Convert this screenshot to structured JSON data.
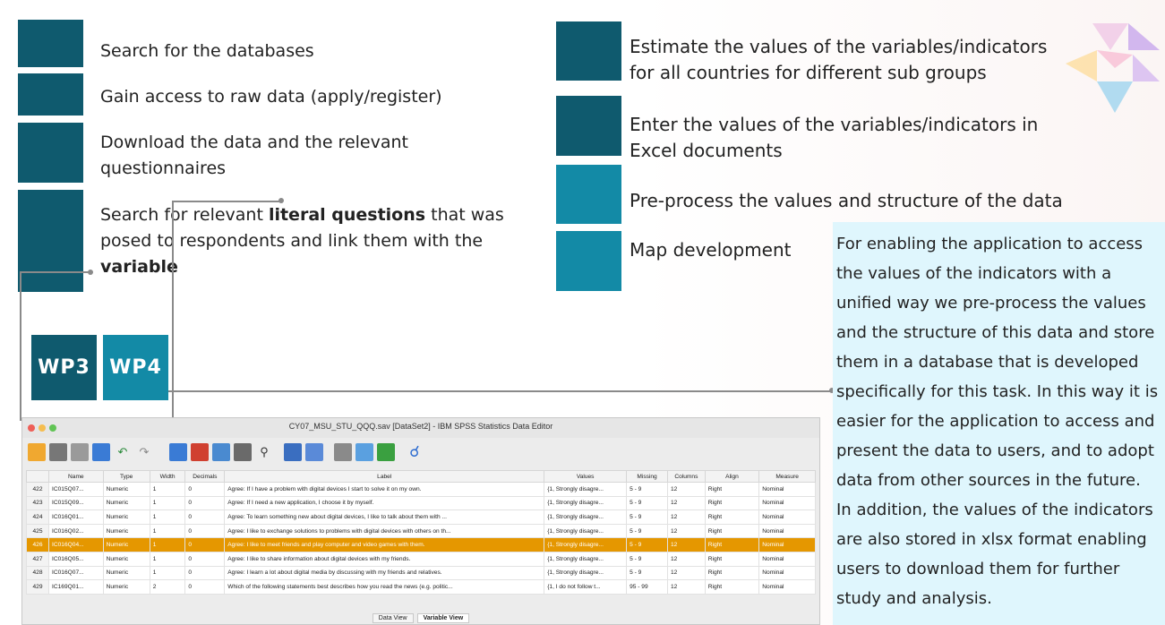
{
  "steps_left": [
    {
      "text": "Search for the databases"
    },
    {
      "text": "Gain access to raw data (apply/register)"
    },
    {
      "line1": "Download the data and the relevant",
      "line2": "questionnaires"
    },
    {
      "pre": "Search for relevant ",
      "bold1": "literal questions",
      "mid": " that was",
      "line2": "posed to respondents and link them with the",
      "bold2": "variable"
    }
  ],
  "steps_right": [
    {
      "line1": "Estimate the values of the variables/indicators",
      "line2": "for all countries for different sub groups"
    },
    {
      "line1": "Enter the values of the variables/indicators in",
      "line2": "Excel documents"
    },
    {
      "text": "Pre-process the values and structure of the data"
    },
    {
      "text": "Map development"
    }
  ],
  "wp_labels": [
    "WP3",
    "WP4"
  ],
  "note_text": "For enabling the application to access the values of the indicators with a unified way we pre-process the values and the structure of this data and store them in a database that is developed specifically for this task. In this way it is easier for the application to access and present the data to users, and to adopt data from other sources in the future. In addition, the values of the indicators are also stored in xlsx format enabling users to download them for further study and analysis.",
  "spss": {
    "title": "CY07_MSU_STU_QQQ.sav [DataSet2] - IBM SPSS Statistics Data Editor",
    "columns": [
      "",
      "Name",
      "Type",
      "Width",
      "Decimals",
      "Label",
      "Values",
      "Missing",
      "Columns",
      "Align",
      "Measure"
    ],
    "rows": [
      [
        "422",
        "IC015Q07...",
        "Numeric",
        "1",
        "0",
        "Agree: If I have a problem with digital devices I start to solve it on my own.",
        "{1, Strongly disagre...",
        "5 - 9",
        "12",
        "Right",
        "Nominal"
      ],
      [
        "423",
        "IC015Q09...",
        "Numeric",
        "1",
        "0",
        "Agree: If I need a new application, I choose it by myself.",
        "{1, Strongly disagre...",
        "5 - 9",
        "12",
        "Right",
        "Nominal"
      ],
      [
        "424",
        "IC016Q01...",
        "Numeric",
        "1",
        "0",
        "Agree: To learn something new about digital devices, I like to talk about them with ...",
        "{1, Strongly disagre...",
        "5 - 9",
        "12",
        "Right",
        "Nominal"
      ],
      [
        "425",
        "IC016Q02...",
        "Numeric",
        "1",
        "0",
        "Agree: I like to exchange solutions to problems with digital devices with others on th...",
        "{1, Strongly disagre...",
        "5 - 9",
        "12",
        "Right",
        "Nominal"
      ],
      [
        "426",
        "IC016Q04...",
        "Numeric",
        "1",
        "0",
        "Agree: I like to meet friends and play computer and video games with them.",
        "{1, Strongly disagre...",
        "5 - 9",
        "12",
        "Right",
        "Nominal"
      ],
      [
        "427",
        "IC016Q05...",
        "Numeric",
        "1",
        "0",
        "Agree: I like to share information about digital devices with my friends.",
        "{1, Strongly disagre...",
        "5 - 9",
        "12",
        "Right",
        "Nominal"
      ],
      [
        "428",
        "IC016Q07...",
        "Numeric",
        "1",
        "0",
        "Agree: I learn a lot about digital media by discussing with my friends and relatives.",
        "{1, Strongly disagre...",
        "5 - 9",
        "12",
        "Right",
        "Nominal"
      ],
      [
        "429",
        "IC169Q01...",
        "Numeric",
        "2",
        "0",
        "Which of the following statements best describes how you read the news (e.g. politic...",
        "{1, I do not follow t...",
        "95 - 99",
        "12",
        "Right",
        "Nominal"
      ]
    ],
    "selected_row": 4,
    "tabs": [
      "Data View",
      "Variable View"
    ],
    "active_tab": 1
  },
  "colors": {
    "dark": "#0f5a6e",
    "light": "#138aa6",
    "note_bg": "#dff6fd",
    "highlight": "#e59700"
  }
}
